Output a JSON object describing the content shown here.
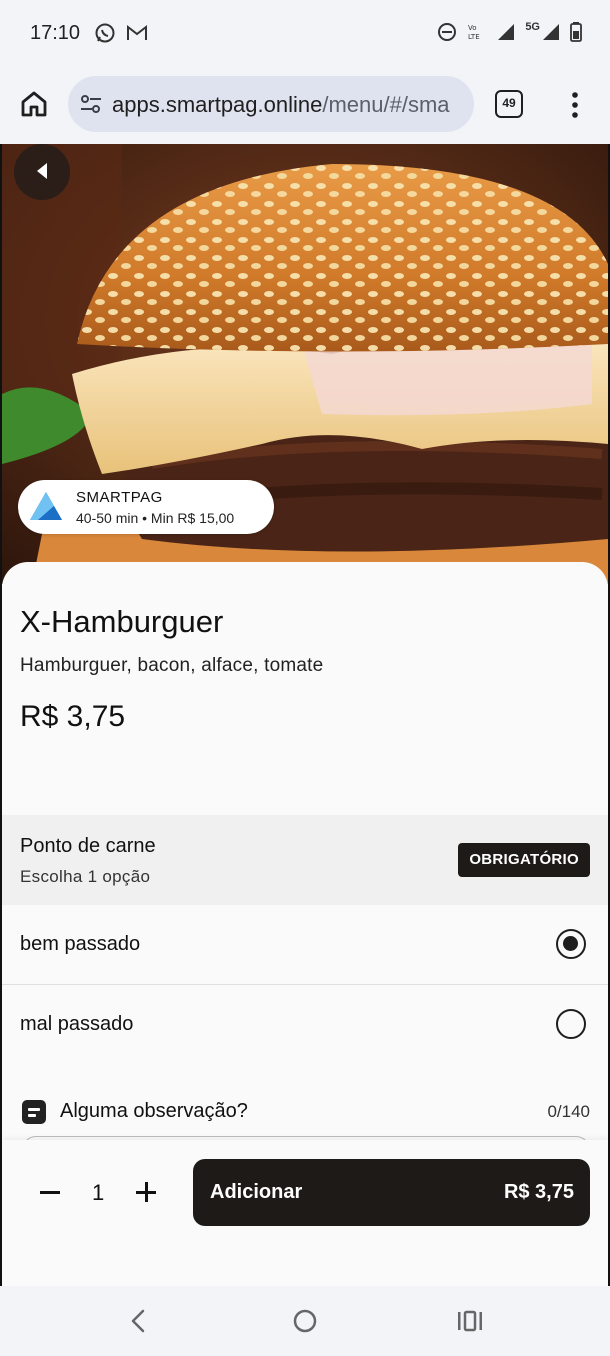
{
  "status_bar": {
    "time": "17:10",
    "network": "5G"
  },
  "browser": {
    "url_host": "apps.smartpag.online",
    "url_path": "/menu/#/sma",
    "tab_count": "49"
  },
  "store": {
    "name": "SMARTPAG",
    "meta": "40-50 min • Min R$ 15,00"
  },
  "product": {
    "title": "X-Hamburguer",
    "description": "Hamburguer, bacon, alface, tomate",
    "price": "R$ 3,75"
  },
  "option_group": {
    "title": "Ponto de carne",
    "subtitle": "Escolha 1 opção",
    "badge": "OBRIGATÓRIO",
    "options": [
      {
        "label": "bem passado",
        "selected": true
      },
      {
        "label": "mal passado",
        "selected": false
      }
    ]
  },
  "observation": {
    "label": "Alguma observação?",
    "count": "0/140"
  },
  "cart": {
    "quantity": "1",
    "add_label": "Adicionar",
    "add_price": "R$ 3,75"
  },
  "colors": {
    "primary_dark": "#1e1a18",
    "browser_bar": "#f3f4f8",
    "url_pill": "#dfe3ef"
  }
}
